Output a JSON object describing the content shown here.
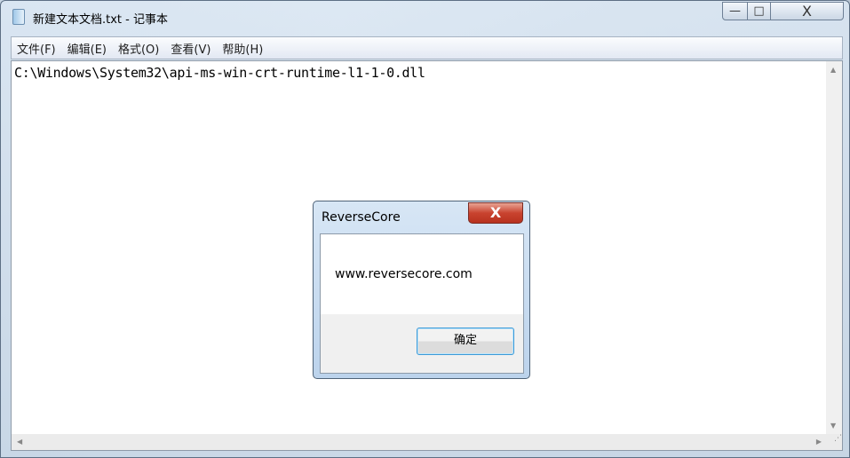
{
  "window": {
    "title": "新建文本文档.txt - 记事本",
    "minimize": "—",
    "maximize": "□",
    "close": "X"
  },
  "menu": [
    "文件(F)",
    "编辑(E)",
    "格式(O)",
    "查看(V)",
    "帮助(H)"
  ],
  "editor": {
    "content": "C:\\Windows\\System32\\api-ms-win-crt-runtime-l1-1-0.dll"
  },
  "dialog": {
    "title": "ReverseCore",
    "close": "X",
    "message": "www.reversecore.com",
    "ok_label": "确定"
  }
}
